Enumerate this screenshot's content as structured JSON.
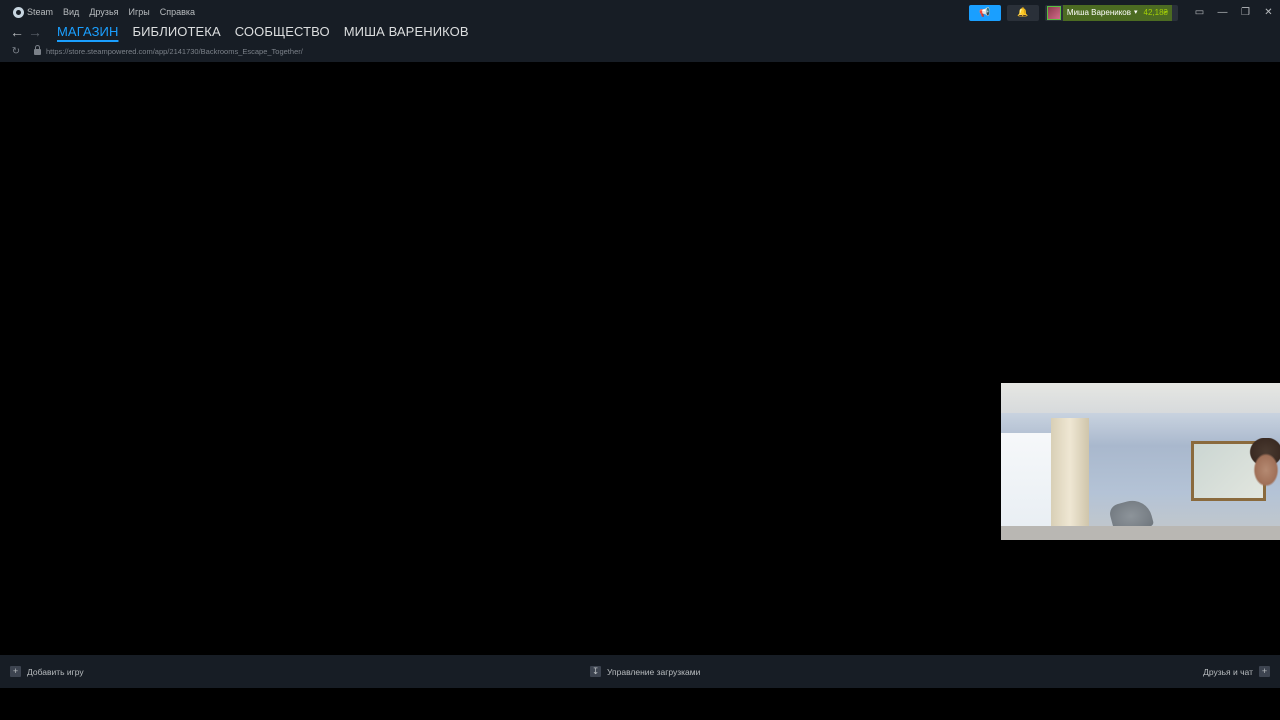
{
  "menubar": {
    "steam": "Steam",
    "view": "Вид",
    "friends": "Друзья",
    "games": "Игры",
    "help": "Справка"
  },
  "nav": {
    "tabs": [
      "МАГАЗИН",
      "БИБЛИОТЕКА",
      "СООБЩЕСТВО",
      "МИША ВАРЕНИКОВ"
    ],
    "active_index": 0
  },
  "url": "https://store.steampowered.com/app/2141730/Backrooms_Escape_Together/",
  "account": {
    "username": "Миша Вареников",
    "balance": "42,18₴"
  },
  "bottom": {
    "add_game": "Добавить игру",
    "downloads": "Управление загрузками",
    "friends_chat": "Друзья и чат"
  },
  "colors": {
    "accent": "#1a9fff",
    "titlebar": "#171d25",
    "balance_bg": "#4c6b22"
  }
}
